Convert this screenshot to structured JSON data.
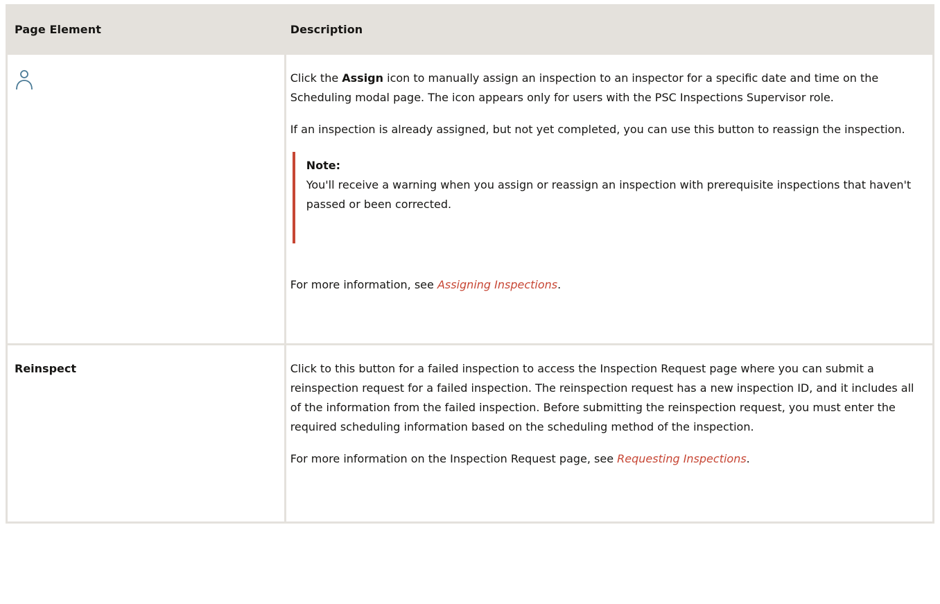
{
  "table": {
    "header": {
      "col1": "Page Element",
      "col2": "Description"
    },
    "rows": [
      {
        "element_icon": "user-icon",
        "paragraphs": {
          "p1_pre": "Click the ",
          "p1_bold": "Assign",
          "p1_post": " icon to manually assign an inspection to an inspector for a specific date and time on the Scheduling modal page. The icon appears only for users with the PSC Inspections Supervisor role.",
          "p2": "If an inspection is already assigned, but not yet completed, you can use this button to reassign the inspection.",
          "note_title": "Note:",
          "note_text": "You'll receive a warning when you assign or reassign an inspection with prerequisite inspections that haven't passed or been corrected.",
          "more_pre": "For more information, see ",
          "more_link": "Assigning Inspections",
          "more_post": "."
        }
      },
      {
        "element_label": "Reinspect",
        "paragraphs": {
          "p1": "Click to this button for a failed inspection to access the Inspection Request page where you can submit a reinspection request for a failed inspection. The reinspection request has a new inspection ID, and it includes all of the information from the failed inspection. Before submitting the reinspection request, you must enter the required scheduling information based on the scheduling method of the inspection.",
          "more_pre": "For more information on the Inspection Request page, see ",
          "more_link": "Requesting Inspections",
          "more_post": "."
        }
      }
    ]
  },
  "colors": {
    "header_bg": "#e4e1dc",
    "border": "#e4e1dc",
    "link": "#c74634",
    "note_bar": "#c74634",
    "icon_stroke": "#4a7a96"
  }
}
